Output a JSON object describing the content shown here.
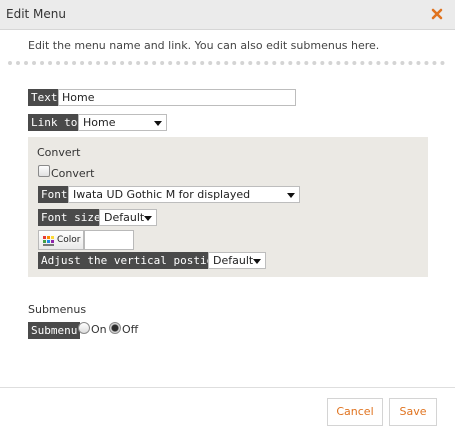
{
  "dialog": {
    "title": "Edit Menu",
    "intro": "Edit the menu name and link. You can also edit submenus here."
  },
  "fields": {
    "text_label": "Text",
    "text_value": "Home",
    "link_label": "Link to",
    "link_value": "Home"
  },
  "convert": {
    "heading": "Convert",
    "checkbox_label": "Convert",
    "checked": false,
    "font_label": "Font",
    "font_value": "Iwata UD Gothic M for displayed",
    "font_size_label": "Font size",
    "font_size_value": "Default",
    "color_button": "Color",
    "adjust_label": "Adjust the vertical postion",
    "adjust_value": "Default"
  },
  "submenus": {
    "heading": "Submenus",
    "label": "Submenu",
    "on_label": "On",
    "off_label": "Off",
    "selected": "Off"
  },
  "footer": {
    "cancel": "Cancel",
    "save": "Save"
  },
  "colors": {
    "accent": "#e0731f",
    "label_bg": "#4a4a4a",
    "panel_bg": "#ebe9e4"
  }
}
